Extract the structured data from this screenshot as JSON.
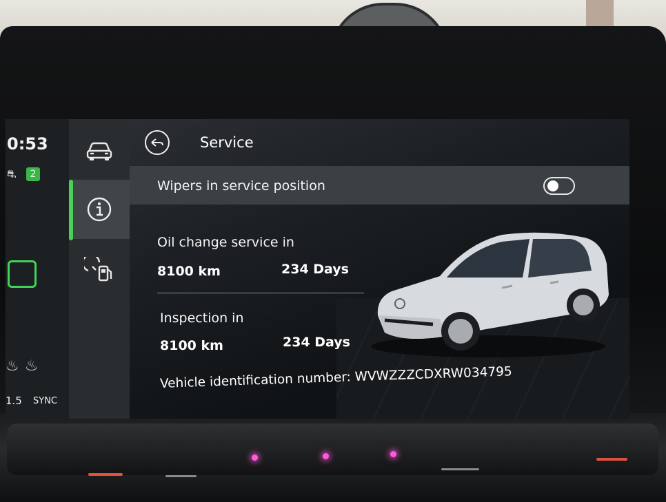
{
  "status": {
    "clock": "0:53",
    "lane_count": "2",
    "temperature": "1.5",
    "sync_label": "SYNC"
  },
  "side_menu": {
    "items": [
      {
        "icon": "car-icon",
        "active": false
      },
      {
        "icon": "info-icon",
        "active": true
      },
      {
        "icon": "service-fuel-icon",
        "active": false
      }
    ],
    "accent_color": "#48d05b"
  },
  "screen": {
    "title": "Service",
    "wipers": {
      "label": "Wipers in service position",
      "toggle_on": false
    },
    "oil_change": {
      "label": "Oil change service in",
      "distance": "8100 km",
      "days": "234 Days"
    },
    "inspection": {
      "label": "Inspection in",
      "distance": "8100 km",
      "days": "234 Days"
    },
    "vin": "Vehicle identification number: WVWZZZCDXRW034795"
  }
}
